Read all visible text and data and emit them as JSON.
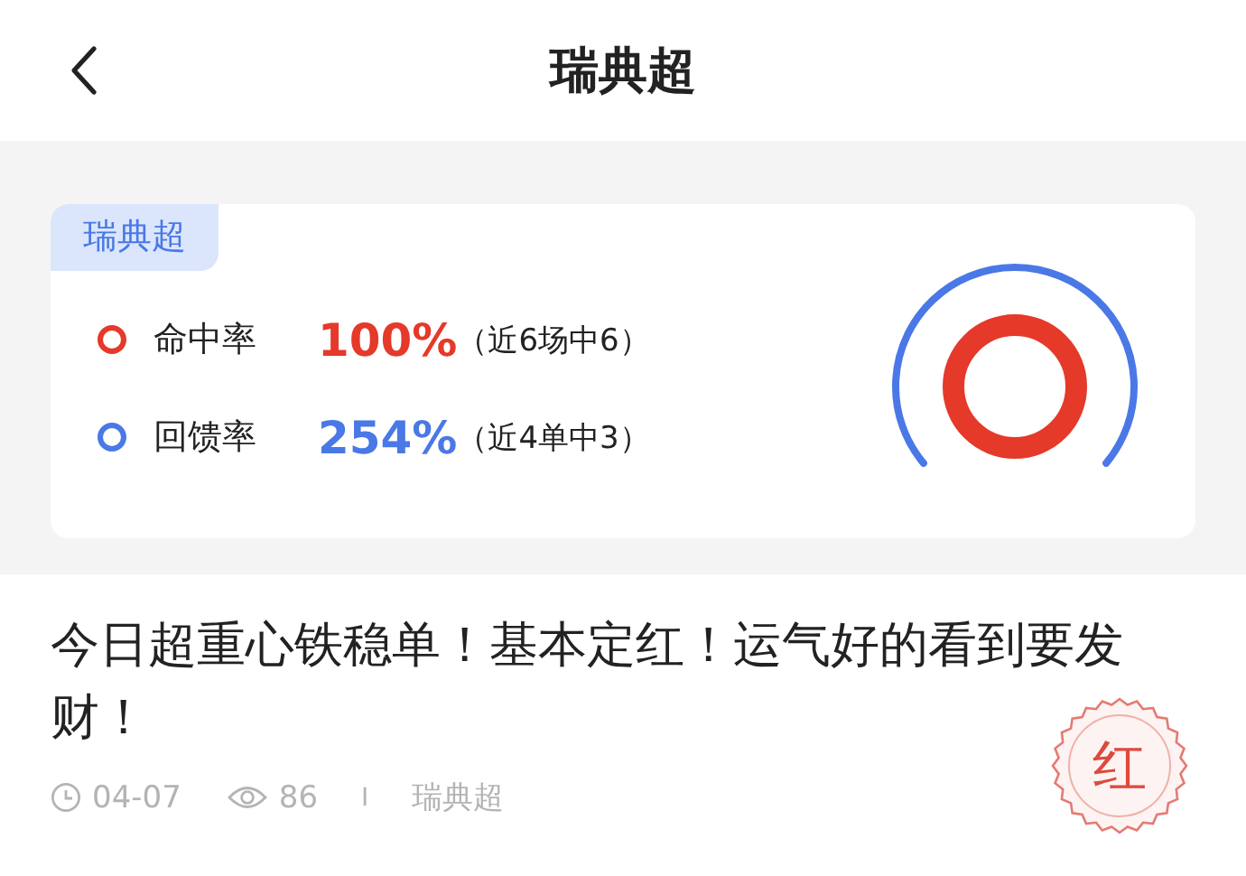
{
  "header": {
    "title": "瑞典超"
  },
  "card": {
    "tag": "瑞典超",
    "metrics": [
      {
        "label": "命中率",
        "value": "100%",
        "note": "（近6场中6）",
        "color": "#e5392a"
      },
      {
        "label": "回馈率",
        "value": "254%",
        "note": "（近4单中3）",
        "color": "#4a78e6"
      }
    ]
  },
  "post": {
    "title": "今日超重心铁稳单！基本定红！运气好的看到要发财！",
    "date": "04-07",
    "views": "86",
    "separator": "I",
    "category": "瑞典超",
    "stamp": "红"
  }
}
